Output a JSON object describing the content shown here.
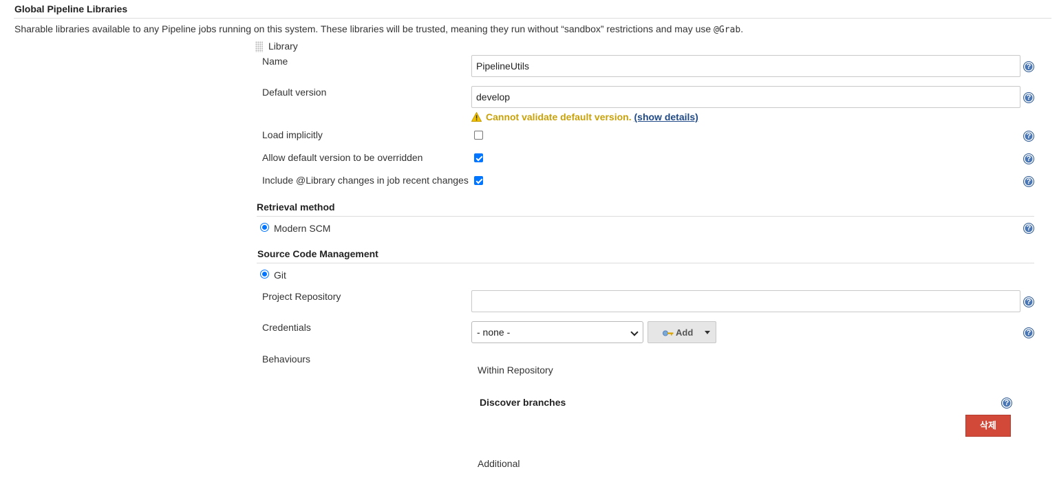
{
  "header": {
    "title": "Global Pipeline Libraries",
    "description_before": "Sharable libraries available to any Pipeline jobs running on this system. These libraries will be trusted, meaning they run without “sandbox” restrictions and may use ",
    "description_code": "@Grab",
    "description_after": "."
  },
  "library": {
    "header": "Library",
    "name_label": "Name",
    "name_value": "PipelineUtils",
    "default_version_label": "Default version",
    "default_version_value": "develop",
    "warning_text": "Cannot validate default version.",
    "warning_link": "(show details)",
    "load_implicitly_label": "Load implicitly",
    "load_implicitly_checked": false,
    "allow_override_label": "Allow default version to be overridden",
    "allow_override_checked": true,
    "include_changes_label": "Include @Library changes in job recent changes",
    "include_changes_checked": true
  },
  "retrieval": {
    "title": "Retrieval method",
    "option": "Modern SCM"
  },
  "scm": {
    "title": "Source Code Management",
    "option": "Git",
    "project_repository_label": "Project Repository",
    "project_repository_value": "",
    "credentials_label": "Credentials",
    "credentials_selected": "- none -",
    "add_label": "Add",
    "behaviours_label": "Behaviours",
    "within_repository": "Within Repository",
    "discover_branches": "Discover branches",
    "delete_label": "삭제",
    "additional": "Additional"
  },
  "colors": {
    "help_icon": "#4a77b4",
    "warning": "#c9a20a",
    "link": "#204a87",
    "delete_button": "#d24939",
    "checkbox_accent": "#0075ff"
  },
  "icons": {
    "help": "question-circle-icon",
    "warning": "warning-triangle-icon",
    "drag": "drag-handle-icon",
    "key": "key-icon",
    "caret": "caret-down-icon"
  }
}
